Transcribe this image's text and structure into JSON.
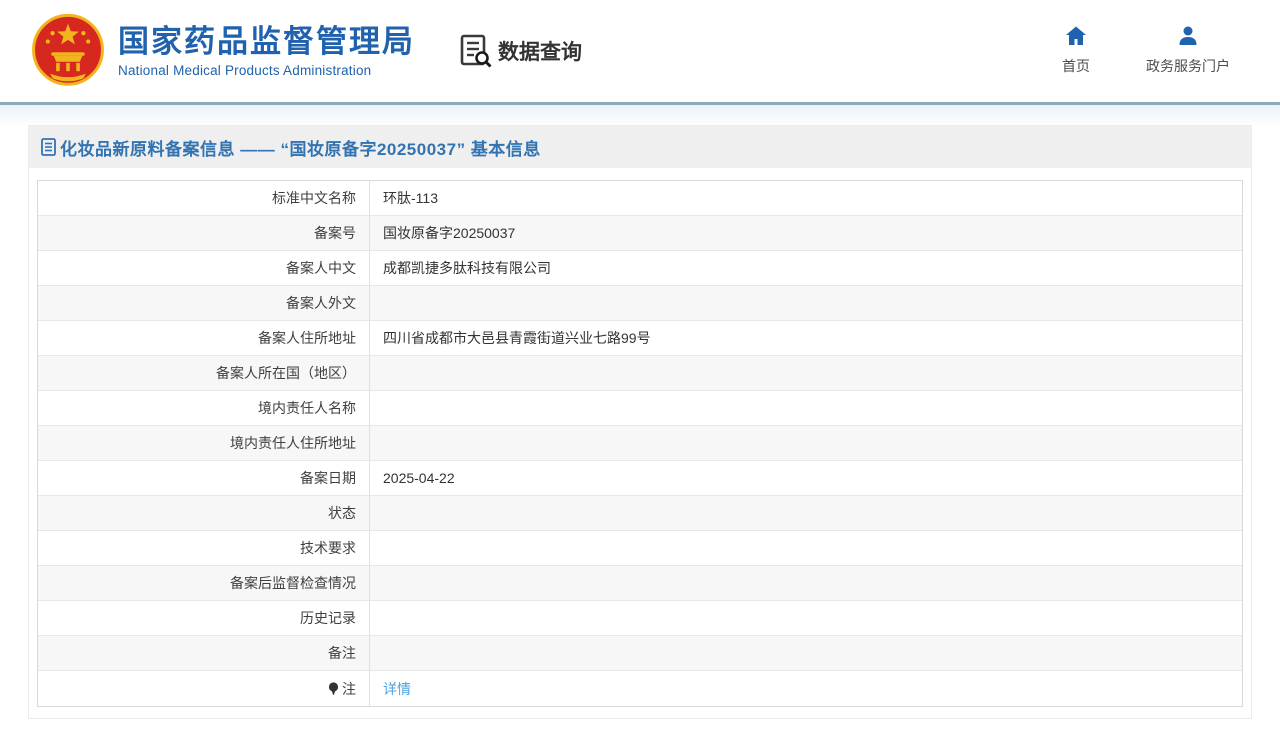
{
  "header": {
    "org_cn": "国家药品监督管理局",
    "org_en": "National Medical Products Administration",
    "nav_query_label": "数据查询",
    "links": [
      {
        "label": "首页",
        "icon": "home-icon"
      },
      {
        "label": "政务服务门户",
        "icon": "user-icon"
      }
    ]
  },
  "page": {
    "title": "化妆品新原料备案信息 —— “国妆原备字20250037” 基本信息"
  },
  "table": {
    "rows": [
      {
        "label": "标准中文名称",
        "value": "环肽-113"
      },
      {
        "label": "备案号",
        "value": "国妆原备字20250037"
      },
      {
        "label": "备案人中文",
        "value": "成都凯捷多肽科技有限公司"
      },
      {
        "label": "备案人外文",
        "value": ""
      },
      {
        "label": "备案人住所地址",
        "value": "四川省成都市大邑县青霞街道兴业七路99号"
      },
      {
        "label": "备案人所在国（地区）",
        "value": ""
      },
      {
        "label": "境内责任人名称",
        "value": ""
      },
      {
        "label": "境内责任人住所地址",
        "value": ""
      },
      {
        "label": "备案日期",
        "value": "2025-04-22"
      },
      {
        "label": "状态",
        "value": ""
      },
      {
        "label": "技术要求",
        "value": ""
      },
      {
        "label": "备案后监督检查情况",
        "value": ""
      },
      {
        "label": "历史记录",
        "value": ""
      },
      {
        "label": "备注",
        "value": ""
      },
      {
        "label": "注",
        "label_icon": "note-bulb-icon",
        "link": {
          "text": "详情"
        }
      }
    ]
  },
  "colors": {
    "brand_blue": "#2062ae",
    "title_blue": "#3273b2",
    "link_blue": "#4aa3df",
    "header_rule": "#8cacbb",
    "alt_row": "#f7f7f7"
  }
}
